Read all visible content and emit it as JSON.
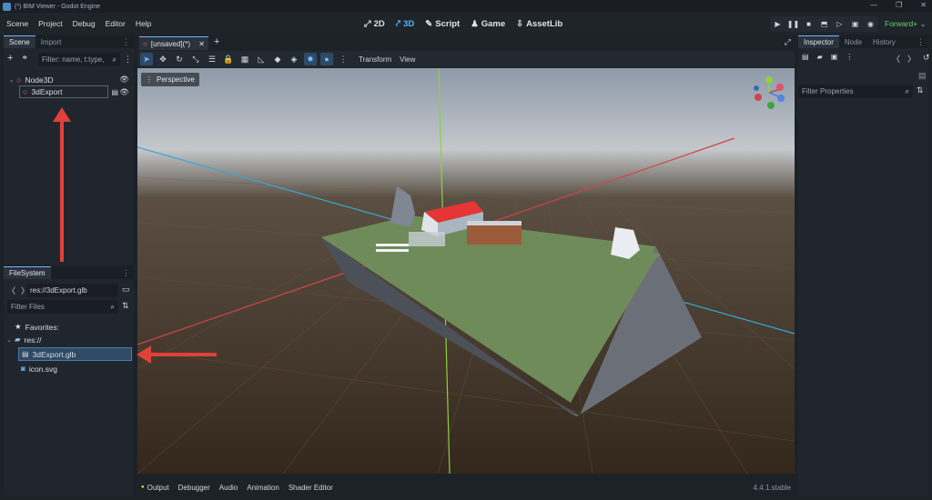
{
  "window": {
    "title": "(*) BIM Viewer - Godot Engine"
  },
  "menu": [
    "Scene",
    "Project",
    "Debug",
    "Editor",
    "Help"
  ],
  "modes": [
    {
      "label": "2D",
      "active": false
    },
    {
      "label": "3D",
      "active": true
    },
    {
      "label": "Script",
      "active": false
    },
    {
      "label": "Game",
      "active": false
    },
    {
      "label": "AssetLib",
      "active": false
    }
  ],
  "renderer": "Forward+",
  "scene_dock": {
    "tabs": [
      "Scene",
      "Import"
    ],
    "filter_placeholder": "Filter: name, t:type,",
    "tree": [
      {
        "label": "Node3D"
      },
      {
        "label": "3dExport"
      }
    ]
  },
  "filesystem_dock": {
    "tab": "FileSystem",
    "path": "res://3dExport.glb",
    "filter_placeholder": "Filter Files",
    "items": [
      {
        "label": "Favorites:"
      },
      {
        "label": "res://"
      },
      {
        "label": "3dExport.glb"
      },
      {
        "label": "icon.svg"
      }
    ]
  },
  "editor": {
    "tab_label": "[unsaved](*)",
    "toolbar_menus": [
      "Transform",
      "View"
    ],
    "perspective_label": "Perspective"
  },
  "inspector": {
    "tabs": [
      "Inspector",
      "Node",
      "History"
    ],
    "filter_placeholder": "Filter Properties"
  },
  "bottom_panel": {
    "tabs": [
      "Output",
      "Debugger",
      "Audio",
      "Animation",
      "Shader Editor"
    ],
    "version": "4.4.1.stable"
  },
  "colors": {
    "accent": "#57b3ff",
    "renderer": "#63d36b",
    "annotation_arrow": "#e0403a",
    "ground": "#6f8b5a",
    "roof": "#e53535"
  }
}
